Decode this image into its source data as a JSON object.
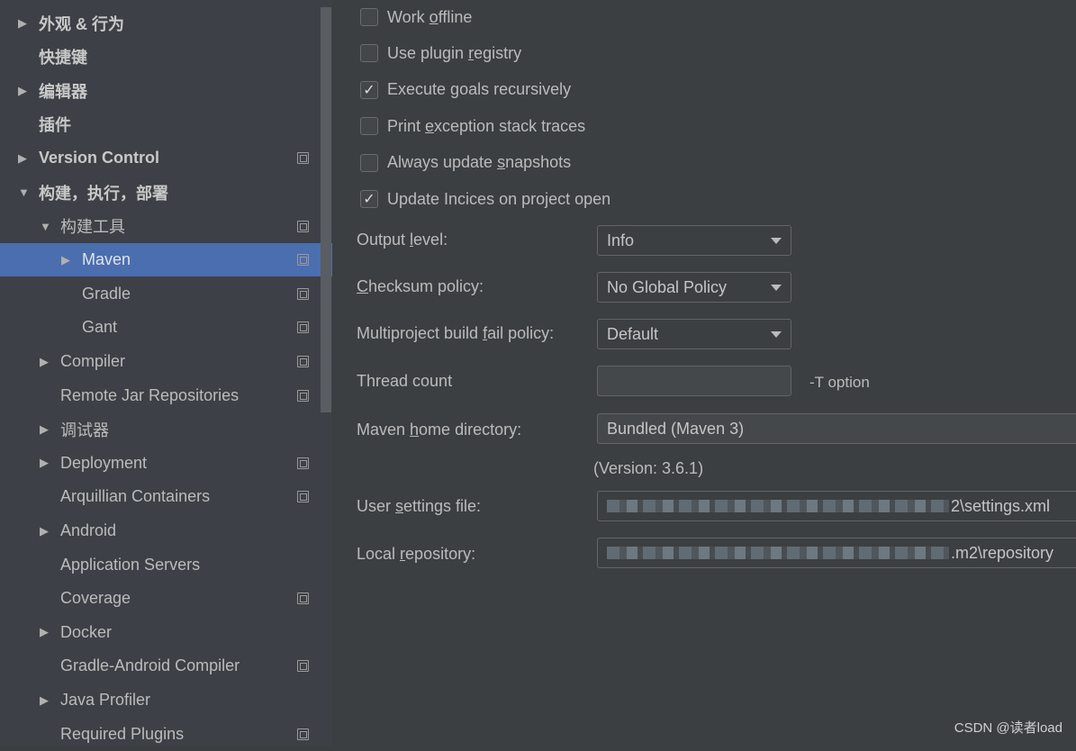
{
  "sidebar": {
    "items": [
      {
        "label": "外观 & 行为",
        "level": 0,
        "arrow": "right",
        "bold": true,
        "copy": false
      },
      {
        "label": "快捷键",
        "level": 0,
        "arrow": "none",
        "bold": true,
        "copy": false
      },
      {
        "label": "编辑器",
        "level": 0,
        "arrow": "right",
        "bold": true,
        "copy": false
      },
      {
        "label": "插件",
        "level": 0,
        "arrow": "none",
        "bold": true,
        "copy": false
      },
      {
        "label": "Version Control",
        "level": 0,
        "arrow": "right",
        "bold": true,
        "copy": true
      },
      {
        "label": "构建，执行，部署",
        "level": 0,
        "arrow": "down",
        "bold": true,
        "copy": false
      },
      {
        "label": "构建工具",
        "level": 1,
        "arrow": "down",
        "bold": false,
        "copy": true
      },
      {
        "label": "Maven",
        "level": 2,
        "arrow": "right",
        "bold": false,
        "copy": true,
        "selected": true
      },
      {
        "label": "Gradle",
        "level": 2,
        "arrow": "none",
        "bold": false,
        "copy": true
      },
      {
        "label": "Gant",
        "level": 2,
        "arrow": "none",
        "bold": false,
        "copy": true
      },
      {
        "label": "Compiler",
        "level": 1,
        "arrow": "right",
        "bold": false,
        "copy": true
      },
      {
        "label": "Remote Jar Repositories",
        "level": 1,
        "arrow": "none",
        "bold": false,
        "copy": true
      },
      {
        "label": "调试器",
        "level": 1,
        "arrow": "right",
        "bold": false,
        "copy": false
      },
      {
        "label": "Deployment",
        "level": 1,
        "arrow": "right",
        "bold": false,
        "copy": true
      },
      {
        "label": "Arquillian Containers",
        "level": 1,
        "arrow": "none",
        "bold": false,
        "copy": true
      },
      {
        "label": "Android",
        "level": 1,
        "arrow": "right",
        "bold": false,
        "copy": false
      },
      {
        "label": "Application Servers",
        "level": 1,
        "arrow": "none",
        "bold": false,
        "copy": false
      },
      {
        "label": "Coverage",
        "level": 1,
        "arrow": "none",
        "bold": false,
        "copy": true
      },
      {
        "label": "Docker",
        "level": 1,
        "arrow": "right",
        "bold": false,
        "copy": false
      },
      {
        "label": "Gradle-Android Compiler",
        "level": 1,
        "arrow": "none",
        "bold": false,
        "copy": true
      },
      {
        "label": "Java Profiler",
        "level": 1,
        "arrow": "right",
        "bold": false,
        "copy": false
      },
      {
        "label": "Required Plugins",
        "level": 1,
        "arrow": "none",
        "bold": false,
        "copy": true
      }
    ]
  },
  "checkboxes": [
    {
      "pre": "Work ",
      "u": "o",
      "post": "ffline",
      "checked": false
    },
    {
      "pre": "Use plugin ",
      "u": "r",
      "post": "egistry",
      "checked": false
    },
    {
      "pre": "Execute ",
      "u": "g",
      "post": "oals recursively",
      "checked": true
    },
    {
      "pre": "Print ",
      "u": "e",
      "post": "xception stack traces",
      "checked": false
    },
    {
      "pre": "Always update ",
      "u": "s",
      "post": "napshots",
      "checked": false
    },
    {
      "pre": "Update Incices on project open",
      "u": "",
      "post": "",
      "checked": true
    }
  ],
  "form": {
    "output_level": {
      "pre": "Output ",
      "u": "l",
      "post": "evel:",
      "value": "Info"
    },
    "checksum": {
      "pre": "",
      "u": "C",
      "post": "hecksum policy:",
      "value": "No Global Policy"
    },
    "multiproject": {
      "pre": "Multiproject build ",
      "u": "f",
      "post": "ail policy:",
      "value": "Default"
    },
    "thread": {
      "label": "Thread count",
      "value": "",
      "hint": "-T option"
    },
    "maven_home": {
      "pre": "Maven ",
      "u": "h",
      "post": "ome directory:",
      "value": "Bundled (Maven 3)",
      "version": "(Version: 3.6.1)"
    },
    "user_settings": {
      "pre": "User ",
      "u": "s",
      "post": "ettings file:",
      "value_visible": "2\\settings.xml"
    },
    "local_repo": {
      "pre": "Local ",
      "u": "r",
      "post": "epository:",
      "value_visible": ".m2\\repository"
    }
  },
  "watermark": "CSDN @读者load",
  "colors": {
    "selection": "#4b6eaf",
    "sidebar_bg": "#3d4046",
    "panel_bg": "#3c3f41"
  }
}
